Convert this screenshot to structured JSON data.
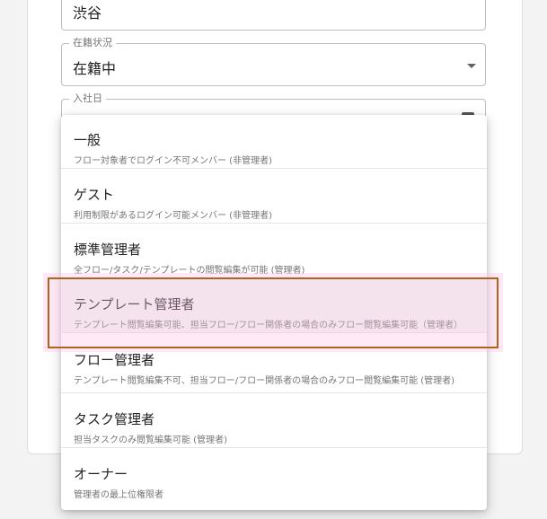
{
  "form": {
    "location_value": "渋谷",
    "status_label": "在籍状況",
    "status_value": "在籍中",
    "join_date_label": "入社日"
  },
  "menu": {
    "items": [
      {
        "title": "一般",
        "desc": "フロー対象者でログイン不可メンバー (非管理者)"
      },
      {
        "title": "ゲスト",
        "desc": "利用制限があるログイン可能メンバー (非管理者)"
      },
      {
        "title": "標準管理者",
        "desc": "全フロー/タスク/テンプレートの閲覧編集が可能 (管理者)"
      },
      {
        "title": "テンプレート管理者",
        "desc": "テンプレート閲覧編集可能、担当フロー/フロー関係者の場合のみフロー閲覧編集可能（管理者）"
      },
      {
        "title": "フロー管理者",
        "desc": "テンプレート閲覧編集不可、担当フロー/フロー関係者の場合のみフロー閲覧編集可能 (管理者)"
      },
      {
        "title": "タスク管理者",
        "desc": "担当タスクのみ閲覧編集可能 (管理者)"
      },
      {
        "title": "オーナー",
        "desc": "管理者の最上位権限者"
      }
    ],
    "selected_index": 3
  },
  "colors": {
    "selected_bg": "#eef6f2",
    "highlight_border": "#b0621f",
    "highlight_glow": "#ffc0e6"
  }
}
